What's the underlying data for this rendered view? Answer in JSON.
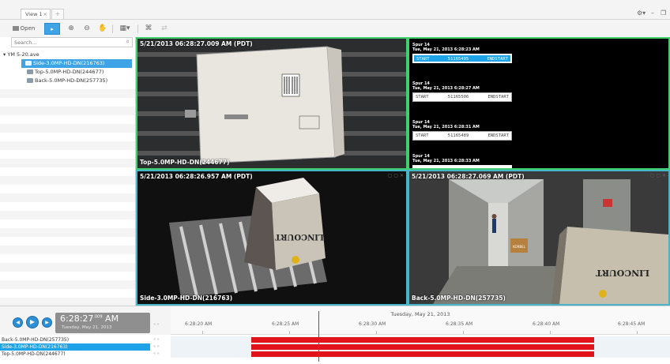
{
  "tabs": {
    "active_label": "View 1",
    "close_glyph": "×",
    "add_glyph": "+"
  },
  "window_controls": {
    "settings": "⚙▾",
    "minimize": "–",
    "restore": "❐"
  },
  "toolbar": {
    "open_label": "Open",
    "select_icon": "▸",
    "zoom_in_icon": "⊕",
    "zoom_out_icon": "⊖",
    "pan_icon": "✋",
    "layout_icon": "▦▾",
    "fullscreen_icon": "⌘",
    "sync_icon": "⇄"
  },
  "sidebar": {
    "search_placeholder": "Search...",
    "search_icon": "⌕",
    "root": "YM 5-20.ave",
    "cameras": [
      {
        "label": "Side-3.0MP-HD-DN(216763)",
        "selected": true
      },
      {
        "label": "Top-5.0MP-HD-DN(244677)",
        "selected": false
      },
      {
        "label": "Back-5.0MP-HD-DN(257735)",
        "selected": false
      }
    ]
  },
  "panes": {
    "top_left": {
      "timestamp": "5/21/2013 06:28:27.009 AM (PDT)",
      "camera": "Top-5.0MP-HD-DN(244677)"
    },
    "top_right": {
      "ocr": [
        {
          "title": "Spur 14",
          "date": "Tue, May 21, 2013 6:28:23 AM",
          "start": "START",
          "code": "51165495",
          "end": "ENDSTART",
          "highlight": true
        },
        {
          "title": "Spur 14",
          "date": "Tue, May 21, 2013 6:28:27 AM",
          "start": "START",
          "code": "51165506",
          "end": "ENDSTART",
          "highlight": false
        },
        {
          "title": "Spur 14",
          "date": "Tue, May 21, 2013 6:28:31 AM",
          "start": "START",
          "code": "51165489",
          "end": "ENDSTART",
          "highlight": false
        },
        {
          "title": "Spur 14",
          "date": "Tue, May 21, 2013 6:28:33 AM"
        }
      ]
    },
    "bottom_left": {
      "timestamp": "5/21/2013 06:28:26.957 AM (PDT)",
      "camera": "Side-3.0MP-HD-DN(216763)",
      "box_text": "LINCOURT"
    },
    "bottom_right": {
      "timestamp": "5/21/2013 06:28:27.069 AM (PDT)",
      "camera": "Back-5.0MP-HD-DN(257735)",
      "box_text": "LINCOURT",
      "box_small_text": "KORBEL"
    }
  },
  "player": {
    "prev_icon": "◀",
    "play_icon": "▶",
    "next_icon": "▶",
    "time": "6:28:27",
    "time_ms": ".009",
    "time_ampm": "AM",
    "date": "Tuesday, May 21, 2013"
  },
  "timeline": {
    "date": "Tuesday, May 21, 2013",
    "ticks": [
      "6:28:20 AM",
      "6:28:25 AM",
      "6:28:30 AM",
      "6:28:35 AM",
      "6:28:40 AM",
      "6:28:45 AM"
    ],
    "nav_arrows": "« »",
    "tracks": [
      {
        "label": "Back-5.0MP-HD-DN(257735)",
        "selected": false
      },
      {
        "label": "Side-3.0MP-HD-DN(216763)",
        "selected": true
      },
      {
        "label": "Top-5.0MP-HD-DN(244677)",
        "selected": false
      }
    ]
  }
}
